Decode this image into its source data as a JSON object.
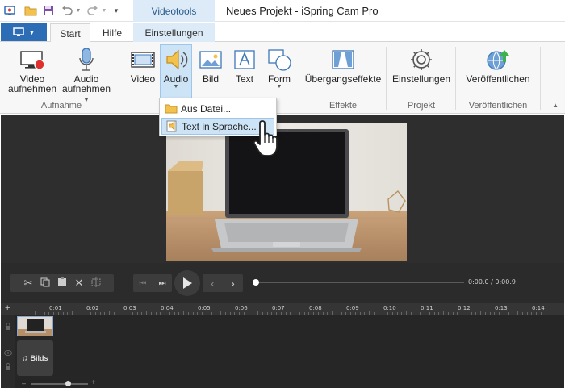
{
  "titlebar": {
    "contextual_tab": "Videotools",
    "window_title": "Neues Projekt - iSpring Cam Pro"
  },
  "tabs": {
    "start": "Start",
    "hilfe": "Hilfe",
    "einstellungen": "Einstellungen"
  },
  "ribbon": {
    "video_aufnehmen": [
      "Video",
      "aufnehmen"
    ],
    "audio_aufnehmen": [
      "Audio",
      "aufnehmen"
    ],
    "aufnahme_group": "Aufnahme",
    "video": "Video",
    "audio": "Audio",
    "bild": "Bild",
    "text": "Text",
    "form": "Form",
    "uebergangseffekte": "Übergangseffekte",
    "effekte_group": "Effekte",
    "einstellungen": "Einstellungen",
    "projekt_group": "Projekt",
    "veroeffentlichen": "Veröffentlichen",
    "veroeffentlichen_group": "Veröffentlichen"
  },
  "audio_menu": {
    "items": [
      "Aus Datei...",
      "Text in Sprache..."
    ],
    "highlighted_index": 1
  },
  "player": {
    "time_display": "0:00.0 / 0:00.9",
    "progress": 0.0
  },
  "timeline": {
    "ticks": [
      "0:01",
      "0:02",
      "0:03",
      "0:04",
      "0:05",
      "0:06",
      "0:07",
      "0:08",
      "0:09",
      "0:10",
      "0:11",
      "0:12",
      "0:13",
      "0:14"
    ],
    "audio_clip_label": "Bilds",
    "add_track": "+",
    "zoom_minus": "–",
    "zoom_plus": "+"
  },
  "colors": {
    "accent": "#2d6db5",
    "contextual_tab": "#dcebf7",
    "menu_highlight": "#cde3f6",
    "timeline_bg": "#262626"
  }
}
